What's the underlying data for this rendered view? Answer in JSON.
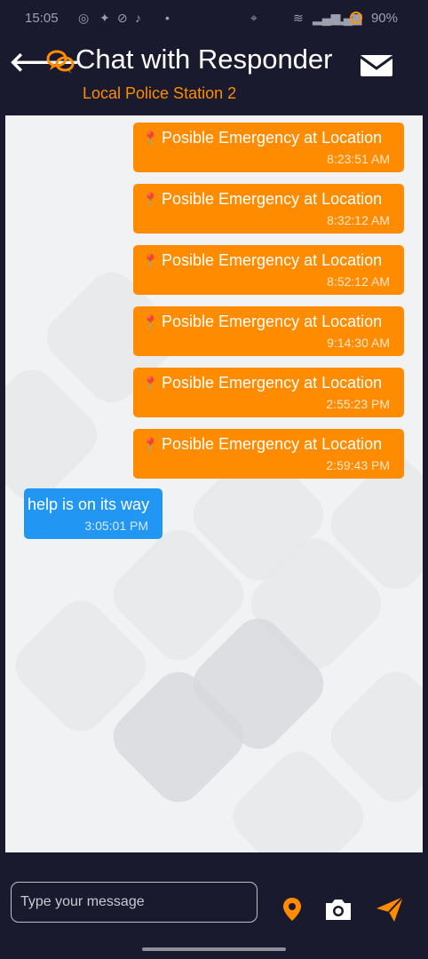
{
  "status_bar": {
    "time": "15:05",
    "battery": "90%"
  },
  "header": {
    "title": "Chat with Responder",
    "subtitle": "Local Police Station 2"
  },
  "messages": [
    {
      "text": "Posible Emergency at Location",
      "time": "8:23:51 AM",
      "direction": "outgoing"
    },
    {
      "text": "Posible Emergency at Location",
      "time": "8:32:12 AM",
      "direction": "outgoing"
    },
    {
      "text": "Posible Emergency at Location",
      "time": "8:52:12 AM",
      "direction": "outgoing"
    },
    {
      "text": "Posible Emergency at Location",
      "time": "9:14:30 AM",
      "direction": "outgoing"
    },
    {
      "text": "Posible Emergency at Location",
      "time": "2:55:23 PM",
      "direction": "outgoing"
    },
    {
      "text": "Posible Emergency at Location",
      "time": "2:59:43 PM",
      "direction": "outgoing"
    },
    {
      "text": "help is on its way",
      "time": "3:05:01 PM",
      "direction": "incoming"
    }
  ],
  "composer": {
    "placeholder": "Type your message",
    "value": ""
  },
  "colors": {
    "accent": "#ff8c00",
    "header_bg": "#191a2e",
    "incoming_bubble": "#2196f3",
    "chat_bg": "#f1f2f4"
  },
  "icons": {
    "back": "back-arrow-icon",
    "chat": "chat-bubbles-icon",
    "mail": "mail-icon",
    "pin": "location-pin-icon",
    "camera": "camera-icon",
    "send": "send-icon"
  }
}
